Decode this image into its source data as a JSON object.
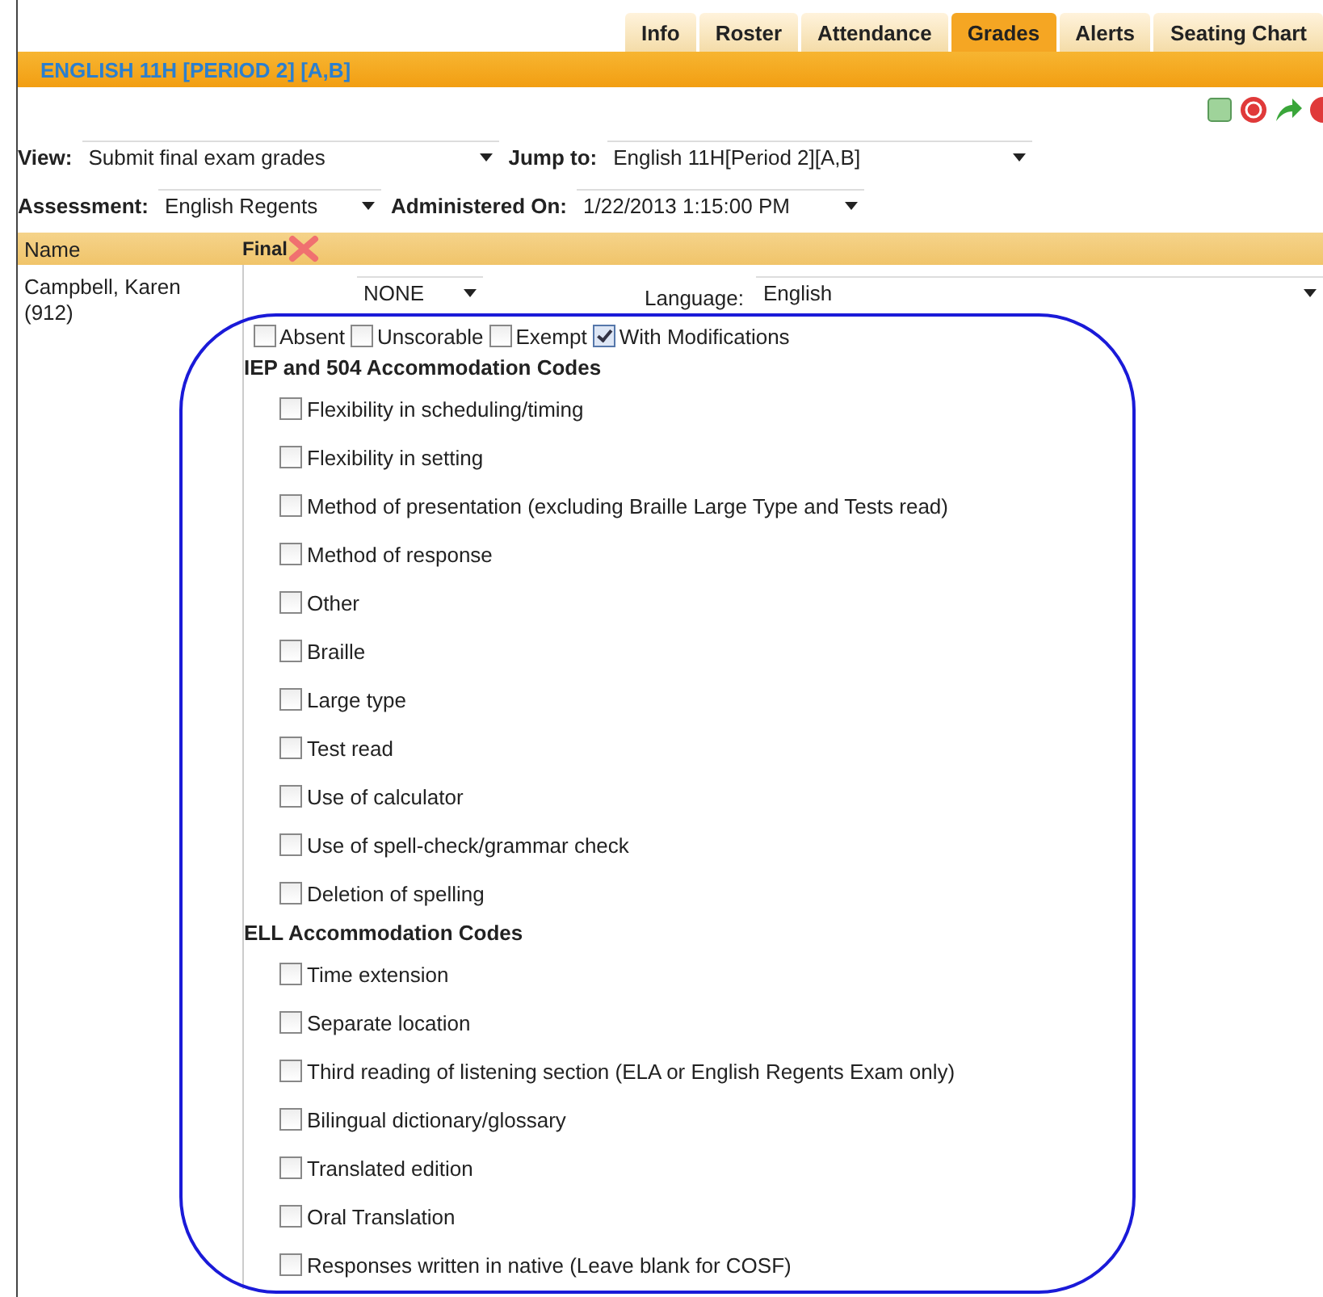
{
  "tabs": [
    {
      "label": "Info",
      "selected": false
    },
    {
      "label": "Roster",
      "selected": false
    },
    {
      "label": "Attendance",
      "selected": false
    },
    {
      "label": "Grades",
      "selected": true
    },
    {
      "label": "Alerts",
      "selected": false
    },
    {
      "label": "Seating Chart",
      "selected": false
    }
  ],
  "title": "ENGLISH 11H [PERIOD 2] [A,B]",
  "filters": [
    {
      "label": "View:",
      "value": "Submit final exam grades",
      "label2": "Jump to:",
      "value2": "English 11H[Period 2][A,B]"
    },
    {
      "label": "Assessment:",
      "value": "English Regents",
      "label2": "Administered On:",
      "value2": "1/22/2013 1:15:00 PM"
    }
  ],
  "table": {
    "columns": [
      "Name",
      "Final"
    ],
    "student": {
      "name": "Campbell, Karen (912)",
      "score": "NONE",
      "language_label": "Language:",
      "language": "English",
      "flags": [
        {
          "label": "Absent",
          "checked": false
        },
        {
          "label": "Unscorable",
          "checked": false
        },
        {
          "label": "Exempt",
          "checked": false
        },
        {
          "label": "With Modifications",
          "checked": true
        }
      ],
      "sections": [
        {
          "heading": "IEP and 504 Accommodation Codes",
          "items": [
            {
              "label": "Flexibility in scheduling/timing",
              "checked": false
            },
            {
              "label": "Flexibility in setting",
              "checked": false
            },
            {
              "label": "Method of presentation (excluding Braille  Large Type  and Tests read)",
              "checked": false
            },
            {
              "label": "Method of response",
              "checked": false
            },
            {
              "label": "Other",
              "checked": false
            },
            {
              "label": "Braille",
              "checked": false
            },
            {
              "label": "Large type",
              "checked": false
            },
            {
              "label": "Test read",
              "checked": false
            },
            {
              "label": "Use of calculator",
              "checked": false
            },
            {
              "label": "Use of spell-check/grammar check",
              "checked": false
            },
            {
              "label": "Deletion of spelling",
              "checked": false
            }
          ]
        },
        {
          "heading": "ELL Accommodation Codes",
          "items": [
            {
              "label": "Time extension",
              "checked": false
            },
            {
              "label": "Separate location",
              "checked": false
            },
            {
              "label": "Third reading of listening section (ELA or English Regents Exam only)",
              "checked": false
            },
            {
              "label": "Bilingual dictionary/glossary",
              "checked": false
            },
            {
              "label": "Translated edition",
              "checked": false
            },
            {
              "label": "Oral Translation",
              "checked": false
            },
            {
              "label": "Responses written in native (Leave blank for COSF)",
              "checked": false
            }
          ]
        }
      ]
    }
  }
}
